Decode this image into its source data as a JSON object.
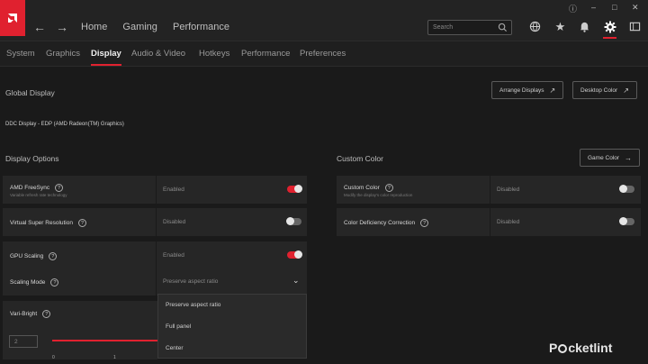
{
  "app": {
    "accent": "#e0212f"
  },
  "topnav": {
    "items": [
      "Home",
      "Gaming",
      "Performance"
    ]
  },
  "search": {
    "placeholder": "Search"
  },
  "tabs": [
    "System",
    "Graphics",
    "Display",
    "Audio & Video",
    "Hotkeys",
    "Performance",
    "Preferences"
  ],
  "active_tab": "Display",
  "global": {
    "title": "Global Display",
    "device": "DDC Display - EDP (AMD Radeon(TM) Graphics)",
    "arrange_label": "Arrange Displays",
    "desktop_color_label": "Desktop Color"
  },
  "display_options": {
    "title": "Display Options",
    "rows": [
      {
        "name": "AMD FreeSync",
        "desc": "Variable refresh rate technology",
        "value": "Enabled",
        "toggle": "on"
      },
      {
        "name": "Virtual Super Resolution",
        "desc": "",
        "value": "Disabled",
        "toggle": "off"
      },
      {
        "name": "GPU Scaling",
        "desc": "",
        "value": "Enabled",
        "toggle": "on"
      },
      {
        "name": "Scaling Mode",
        "desc": "",
        "value": "Preserve aspect ratio",
        "toggle": "dropdown"
      },
      {
        "name": "Vari-Bright",
        "desc": "",
        "value": "",
        "toggle": ""
      }
    ]
  },
  "scaling_mode_options": [
    "Preserve aspect ratio",
    "Full panel",
    "Center"
  ],
  "vari_bright": {
    "value": "2",
    "ticks": [
      "0",
      "1"
    ]
  },
  "custom_color": {
    "title": "Custom Color",
    "game_color_label": "Game Color",
    "rows": [
      {
        "name": "Custom Color",
        "desc": "Modify the display's color reproduction",
        "value": "Disabled",
        "toggle": "off"
      },
      {
        "name": "Color Deficiency Correction",
        "desc": "",
        "value": "Disabled",
        "toggle": "off"
      }
    ]
  },
  "watermark": {
    "text_pre": "P",
    "text_post": "cketlint"
  }
}
